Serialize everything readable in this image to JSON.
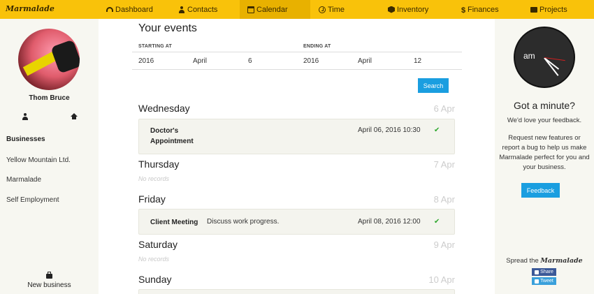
{
  "brand": "Marmalade",
  "nav": [
    {
      "label": "Dashboard",
      "icon": "dashboard-icon"
    },
    {
      "label": "Contacts",
      "icon": "user-icon"
    },
    {
      "label": "Calendar",
      "icon": "calendar-icon",
      "active": true
    },
    {
      "label": "Time",
      "icon": "clock-icon"
    },
    {
      "label": "Inventory",
      "icon": "box-icon"
    },
    {
      "label": "Finances",
      "icon": "dollar-icon"
    },
    {
      "label": "Projects",
      "icon": "folder-icon"
    }
  ],
  "sidebar": {
    "username": "Thom Bruce",
    "businesses_title": "Businesses",
    "businesses": [
      "Yellow Mountain Ltd.",
      "Marmalade",
      "Self Employment"
    ],
    "new_business": "New business"
  },
  "main": {
    "title": "Your events",
    "filter": {
      "starting_label": "STARTING AT",
      "ending_label": "ENDING AT",
      "start": {
        "year": "2016",
        "month": "April",
        "day": "6"
      },
      "end": {
        "year": "2016",
        "month": "April",
        "day": "12"
      },
      "search_label": "Search"
    },
    "days": [
      {
        "name": "Wednesday",
        "date": "6 Apr"
      },
      {
        "name": "Thursday",
        "date": "7 Apr",
        "empty": "No records"
      },
      {
        "name": "Friday",
        "date": "8 Apr"
      },
      {
        "name": "Saturday",
        "date": "9 Apr",
        "empty": "No records"
      },
      {
        "name": "Sunday",
        "date": "10 Apr"
      }
    ],
    "events": [
      {
        "title_line1": "Doctor's",
        "title_line2": "Appointment",
        "description": "",
        "time": "April 06, 2016 10:30",
        "status": "✔"
      },
      {
        "title_line1": "Client Meeting",
        "title_line2": "",
        "description": "Discuss work progress.",
        "time": "April 08, 2016 12:00",
        "status": "✔"
      }
    ]
  },
  "right": {
    "clock_label": "am",
    "got_a_minute": "Got a minute?",
    "love": "We'd love your feedback.",
    "request": "Request new features or report a bug to help us make Marmalade perfect for you and your business.",
    "feedback_label": "Feedback",
    "spread_prefix": "Spread the",
    "spread_brand": "Marmalade",
    "share_label": "Share",
    "tweet_label": "Tweet"
  },
  "colors": {
    "nav": "#f9c20a",
    "nav_active": "#e8b100",
    "button": "#1a9ee0",
    "check": "#2ea82e"
  }
}
